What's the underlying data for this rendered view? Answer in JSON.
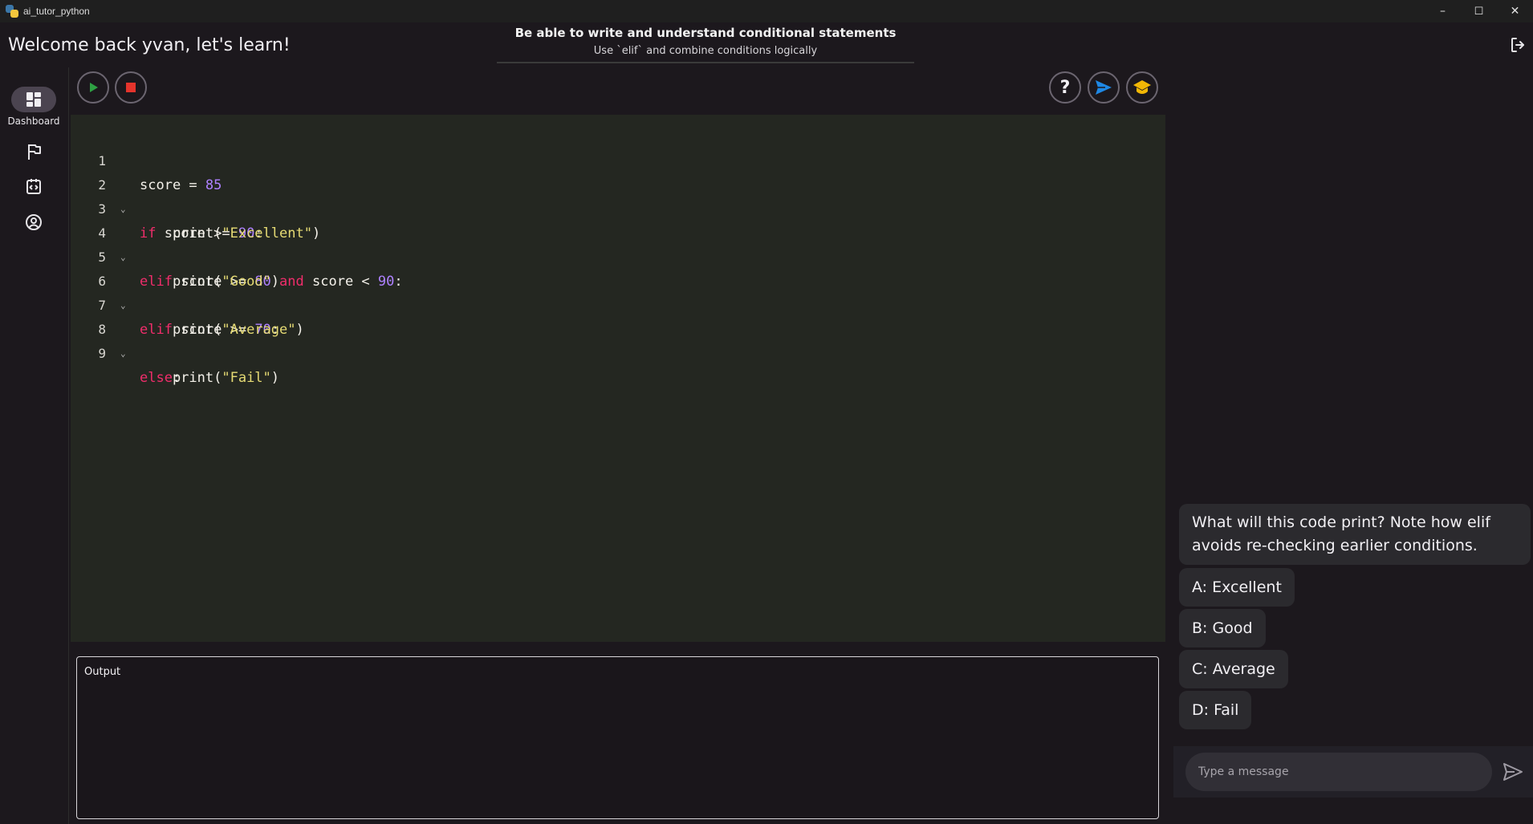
{
  "window": {
    "title": "ai_tutor_python",
    "minimize": "–",
    "maximize": "☐",
    "close": "✕"
  },
  "header": {
    "welcome": "Welcome back yvan, let's learn!",
    "objective_title": "Be able to write and understand conditional statements",
    "objective_subtitle": "Use `elif` and combine conditions logically"
  },
  "nav": {
    "dashboard_label": "Dashboard"
  },
  "toolbar": {
    "help_label": "?"
  },
  "editor": {
    "line_numbers": [
      "1",
      "2",
      "3",
      "4",
      "5",
      "6",
      "7",
      "8",
      "9"
    ]
  },
  "output": {
    "label": "Output"
  },
  "chat": {
    "question": "What will this code print? Note how elif avoids re-checking earlier conditions.",
    "options": [
      "A: Excellent",
      "B: Good",
      "C: Average",
      "D: Fail"
    ],
    "input_placeholder": "Type a message"
  },
  "colors": {
    "keyword": "#f02d6b",
    "number": "#ae81ff",
    "string": "#e6db74",
    "run": "#2ea043",
    "stop": "#e5342c",
    "send": "#1e88e5",
    "tutor": "#f2b705"
  }
}
